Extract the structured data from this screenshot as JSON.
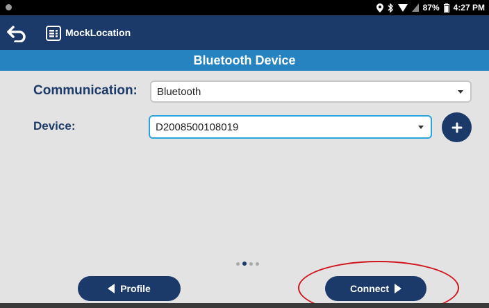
{
  "status_bar": {
    "battery": "87%",
    "time": "4:27 PM"
  },
  "app_bar": {
    "title": "MockLocation"
  },
  "screen": {
    "title": "Bluetooth Device"
  },
  "form": {
    "communication": {
      "label": "Communication:",
      "value": "Bluetooth"
    },
    "device": {
      "label": "Device:",
      "value": "D2008500108019"
    }
  },
  "pager": {
    "pages": 4,
    "active_index": 1
  },
  "buttons": {
    "profile": "Profile",
    "connect": "Connect"
  },
  "colors": {
    "navy": "#1b3a69",
    "blue": "#2683c0",
    "highlight": "#d0141c"
  },
  "icons": {
    "back": "back-arrow-icon",
    "app": "list-icon",
    "add": "plus-icon"
  }
}
